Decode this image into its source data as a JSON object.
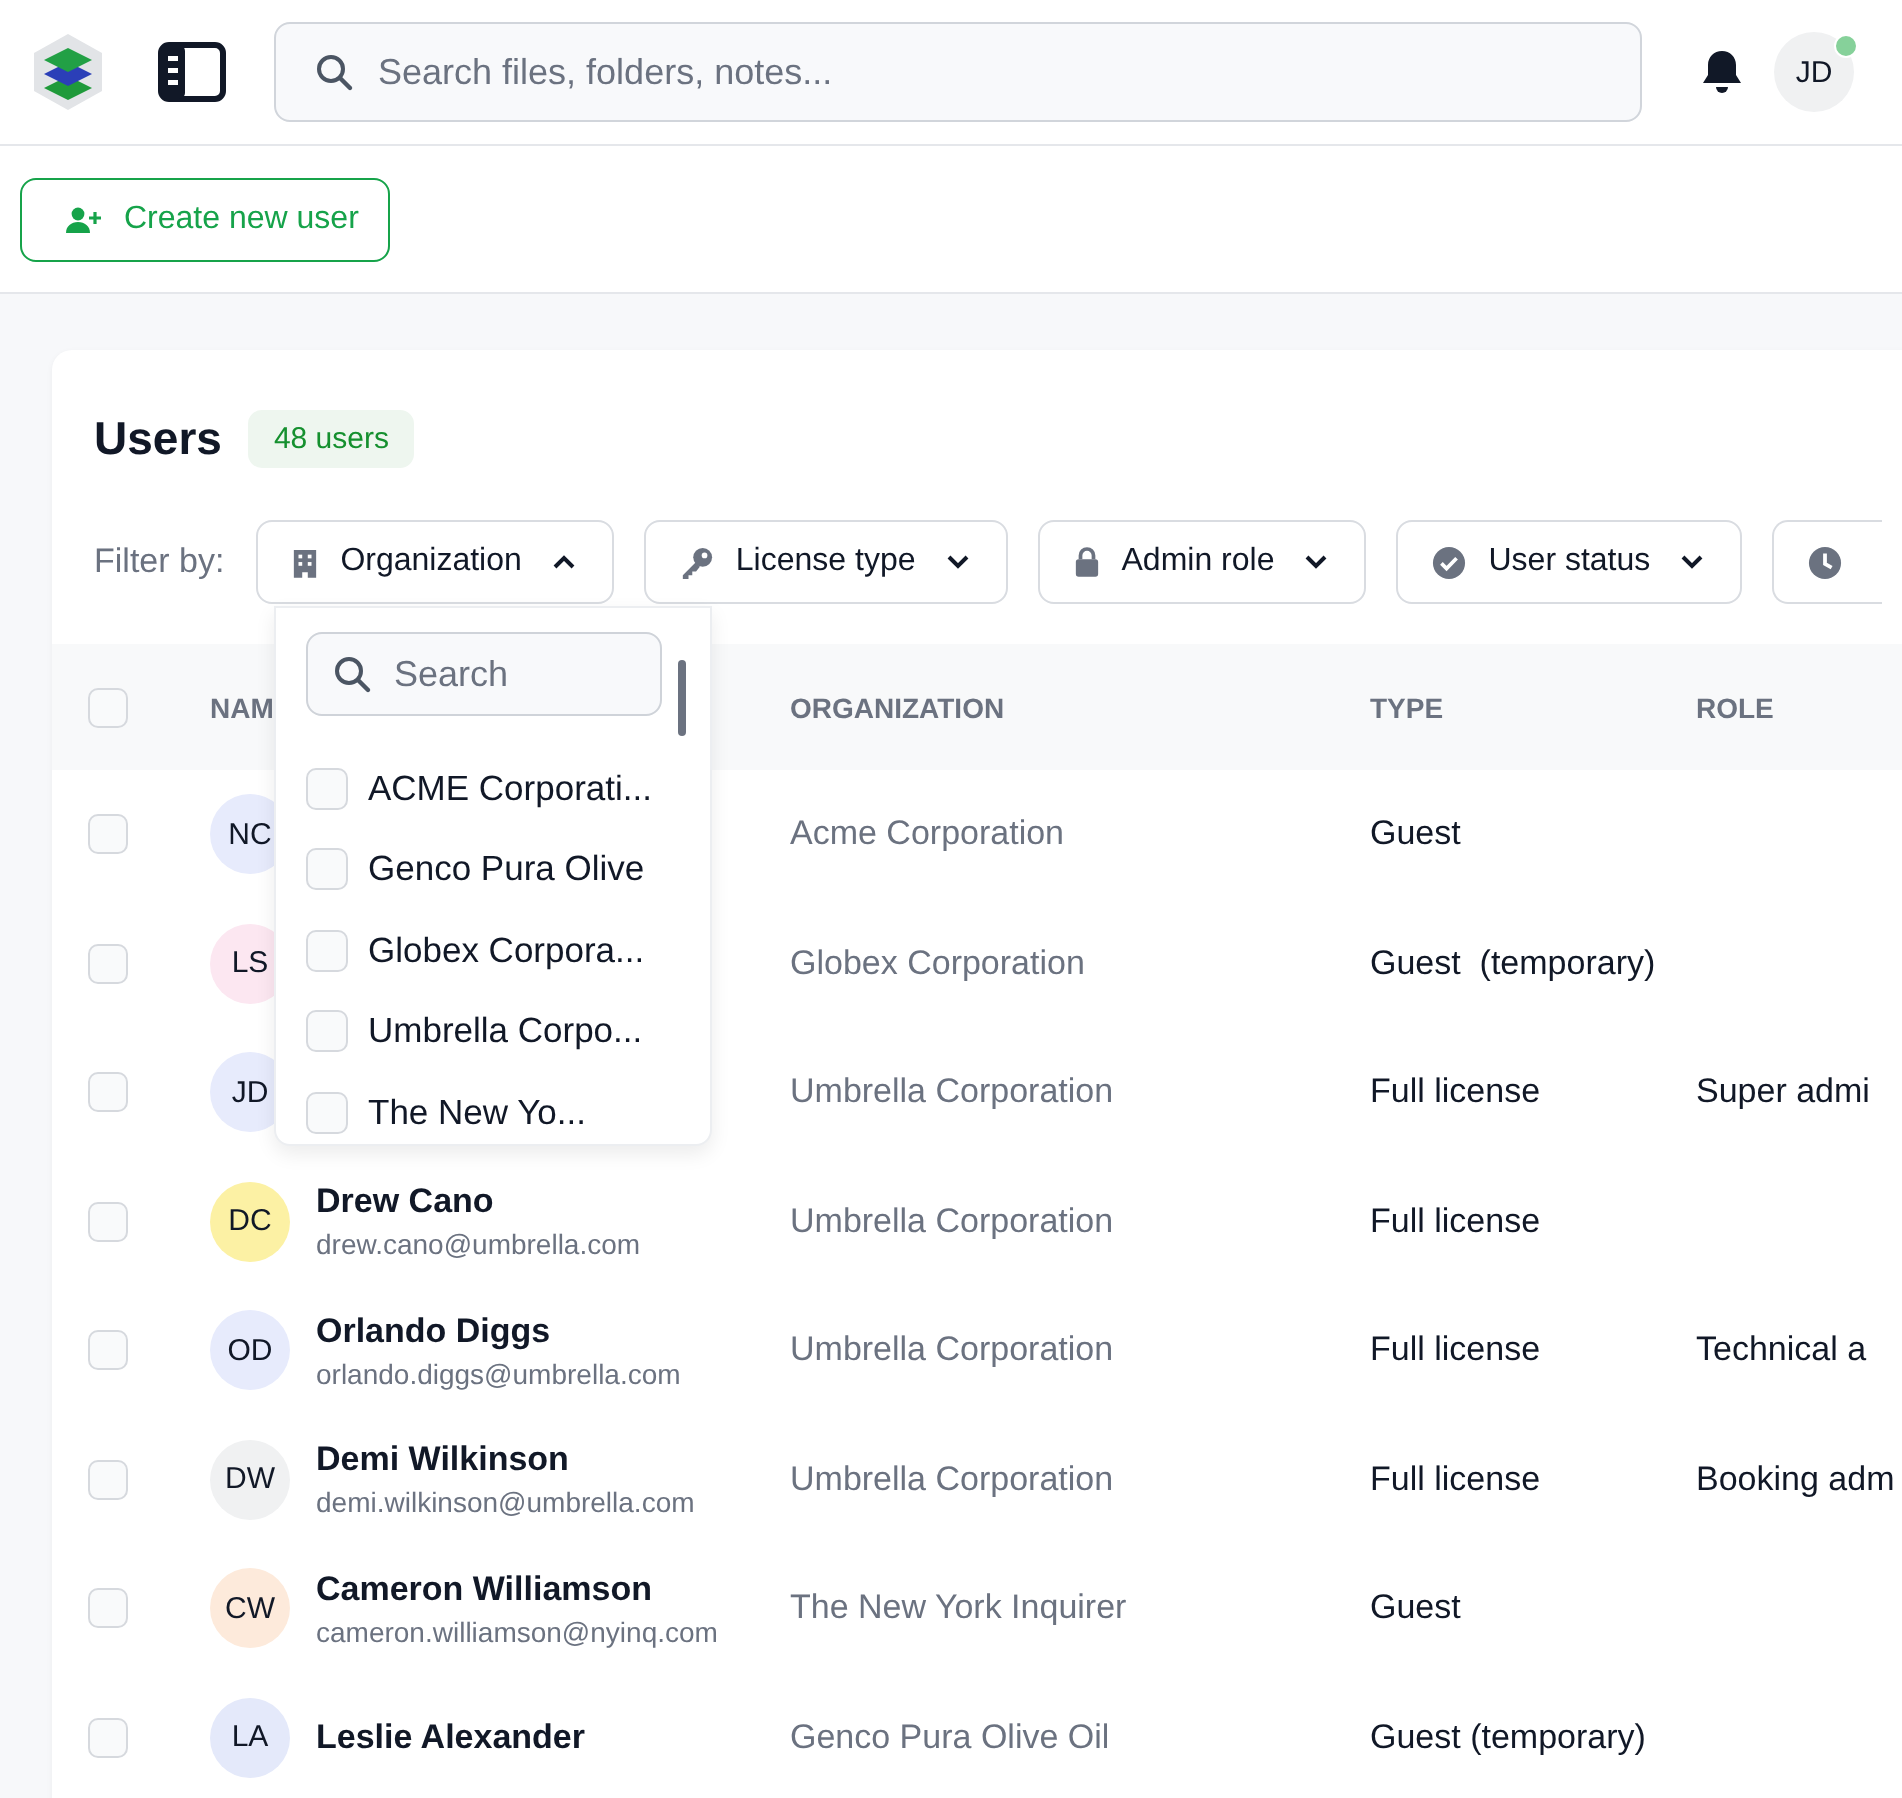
{
  "header": {
    "search": {
      "placeholder": "Search files, folders, notes..."
    },
    "avatar": {
      "initials": "JD",
      "online": true
    }
  },
  "toolbar": {
    "create_button": "Create new user"
  },
  "users_panel": {
    "title": "Users",
    "count": "48 users",
    "filter_label": "Filter by:",
    "filters": [
      {
        "kind": "building",
        "label": "Organization",
        "expanded": true
      },
      {
        "kind": "key",
        "label": "License type",
        "expanded": false
      },
      {
        "kind": "lock",
        "label": "Admin role",
        "expanded": false
      },
      {
        "kind": "status",
        "label": "User status",
        "expanded": false
      },
      {
        "kind": "clock"
      }
    ],
    "dropdown": {
      "search_placeholder": "Search",
      "options": [
        {
          "label": "ACME Corporati...",
          "checked": false
        },
        {
          "label": "Genco Pura Olive",
          "checked": false
        },
        {
          "label": "Globex Corpora...",
          "checked": false
        },
        {
          "label": "Umbrella Corpo...",
          "checked": false
        },
        {
          "label": "The New Yo...",
          "checked": false
        }
      ]
    },
    "table": {
      "select_all": false,
      "columns": [
        "NAM",
        "ORGANIZATION",
        "TYPE",
        "ROLE"
      ],
      "rows": [
        {
          "selected": false,
          "initials": "NC",
          "color": "#e7ebfc",
          "organization": "Acme Corporation",
          "type": "Guest"
        },
        {
          "selected": false,
          "initials": "LS",
          "color": "#fce7f1",
          "organization": "Globex Corporation",
          "type": "Guest  (temporary)"
        },
        {
          "selected": false,
          "initials": "JD",
          "color": "#e7ebfc",
          "organization": "Umbrella Corporation",
          "type": "Full license",
          "role": "Super admi"
        },
        {
          "selected": false,
          "initials": "DC",
          "color": "#fcf1a4",
          "name": "Drew Cano",
          "email": "drew.cano@umbrella.com",
          "organization": "Umbrella Corporation",
          "type": "Full license"
        },
        {
          "selected": false,
          "initials": "OD",
          "color": "#e7ebfc",
          "name": "Orlando Diggs",
          "email": "orlando.diggs@umbrella.com",
          "organization": "Umbrella Corporation",
          "type": "Full license",
          "role": "Technical a"
        },
        {
          "selected": false,
          "initials": "DW",
          "color": "#f0f1f2",
          "name": "Demi Wilkinson",
          "email": "demi.wilkinson@umbrella.com",
          "organization": "Umbrella Corporation",
          "type": "Full license",
          "role": "Booking adm"
        },
        {
          "selected": false,
          "initials": "CW",
          "color": "#fdeadb",
          "name": "Cameron Williamson",
          "email": "cameron.williamson@nyinq.com",
          "organization": "The New York Inquirer",
          "type": "Guest"
        },
        {
          "selected": false,
          "initials": "LA",
          "color": "#e4e9fa",
          "name": "Leslie Alexander",
          "organization": "Genco Pura Olive Oil",
          "type": "Guest (temporary)"
        }
      ]
    }
  }
}
